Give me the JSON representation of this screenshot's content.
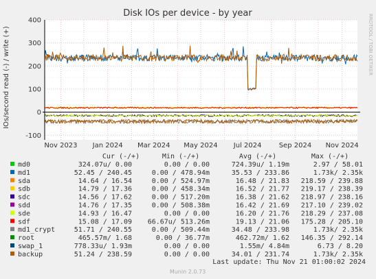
{
  "chart_data": {
    "type": "line",
    "title": "Disk IOs per device - by year",
    "ylabel": "IOs/second read (-) / write (+)",
    "watermark": "RRDTOOL / TOBI OETIKER",
    "ylim": [
      -120,
      400
    ],
    "yticks": [
      -100,
      0,
      100,
      200,
      300,
      400
    ],
    "xticks": [
      "Nov 2023",
      "Jan 2024",
      "Mar 2024",
      "May 2024",
      "Jul 2024",
      "Sep 2024",
      "Nov 2024"
    ],
    "x_range": [
      "2023-10-11",
      "2024-11-21"
    ],
    "grid": true,
    "columns": [
      "Cur (-/+)",
      "Min (-/+)",
      "Avg (-/+)",
      "Max (-/+)"
    ],
    "series": [
      {
        "name": "md0",
        "color": "#00cc00",
        "cur": "324.07u/   0.00",
        "min": "0.00 /   0.00",
        "avg": "724.39u/   1.19m",
        "max": "2.97 /  58.01"
      },
      {
        "name": "md1",
        "color": "#0066b3",
        "cur": "52.45 / 240.45",
        "min": "0.00 / 478.94m",
        "avg": "35.53 / 233.86",
        "max": "1.73k/   2.35k"
      },
      {
        "name": "sda",
        "color": "#ff8000",
        "cur": "14.64 /  16.54",
        "min": "0.00 / 524.97m",
        "avg": "16.48 /  21.83",
        "max": "218.59 / 239.88"
      },
      {
        "name": "sdb",
        "color": "#ffcc00",
        "cur": "14.79 /  17.36",
        "min": "0.00 / 458.34m",
        "avg": "16.52 /  21.77",
        "max": "219.17 / 238.39"
      },
      {
        "name": "sdc",
        "color": "#330099",
        "cur": "14.56 /  17.62",
        "min": "0.00 / 517.20m",
        "avg": "16.38 /  21.62",
        "max": "218.97 / 238.16"
      },
      {
        "name": "sdd",
        "color": "#990099",
        "cur": "14.76 /  17.35",
        "min": "0.00 / 508.38m",
        "avg": "16.42 /  21.69",
        "max": "217.10 / 239.02"
      },
      {
        "name": "sde",
        "color": "#ccff00",
        "cur": "14.93 /  16.47",
        "min": "0.00 /   0.00",
        "avg": "16.20 /  21.76",
        "max": "218.29 / 237.08"
      },
      {
        "name": "sdf",
        "color": "#ff0000",
        "cur": "15.08 /  17.09",
        "min": "66.67u/ 513.26m",
        "avg": "19.13 /  21.06",
        "max": "175.28 / 205.10"
      },
      {
        "name": "md1_crypt",
        "color": "#808080",
        "cur": "51.71 / 240.55",
        "min": "0.00 / 509.44m",
        "avg": "34.48 / 233.98",
        "max": "1.73k/   2.35k"
      },
      {
        "name": "root",
        "color": "#008f00",
        "cur": "465.57m/   1.68",
        "min": "0.00 /  36.77m",
        "avg": "462.72m/   1.62",
        "max": "146.35 / 292.14"
      },
      {
        "name": "swap_1",
        "color": "#00487d",
        "cur": "778.33u/   1.93m",
        "min": "0.00 /   0.00",
        "avg": "1.55m/   4.84m",
        "max": "6.73 /   8.20"
      },
      {
        "name": "backup",
        "color": "#b35a00",
        "cur": "51.24 / 238.59",
        "min": "0.00 /   0.00",
        "avg": "34.01 / 231.74",
        "max": "1.73k/   2.35k"
      }
    ],
    "profiles": {
      "write_high": {
        "base": 235,
        "noise": 14,
        "spike": 60,
        "dip_from": "2024-07-01",
        "dip_to": "2024-07-12",
        "dip_level": 100
      },
      "write_low": {
        "base": 20,
        "noise": 3
      },
      "read_low": {
        "base": -15,
        "noise": 4
      },
      "read_high": {
        "base": -40,
        "noise": 8
      }
    }
  },
  "footer": {
    "last_update": "Last update: Thu Nov 21 01:00:02 2024",
    "version": "Munin 2.0.73"
  }
}
